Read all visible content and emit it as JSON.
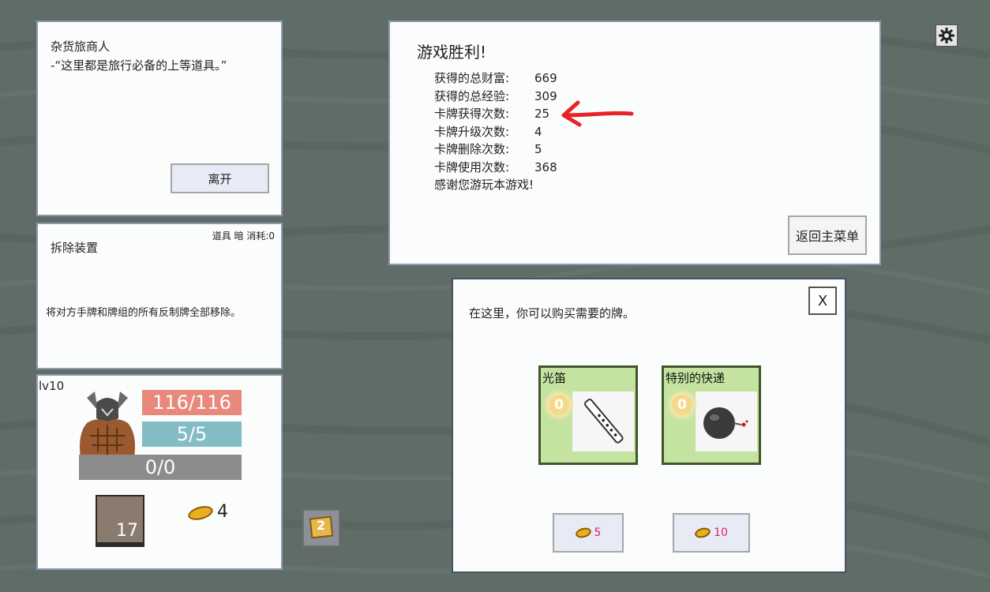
{
  "merchant": {
    "name": "杂货旅商人",
    "quote": "-“这里都是旅行必备的上等道具。”",
    "leave_label": "离开"
  },
  "card_info": {
    "meta": "道具 暗 消耗:0",
    "title": "拆除装置",
    "description": "将对方手牌和牌组的所有反制牌全部移除。"
  },
  "player": {
    "level": "lv10",
    "hp": "116/116",
    "mp": "5/5",
    "xp": "0/0",
    "deck_count": "17",
    "gold": "4",
    "pack_count": "2"
  },
  "victory": {
    "title": "游戏胜利!",
    "stats": [
      {
        "label": "获得的总财富:",
        "value": "669"
      },
      {
        "label": "获得的总经验:",
        "value": "309"
      },
      {
        "label": "卡牌获得次数:",
        "value": "25"
      },
      {
        "label": "卡牌升级次数:",
        "value": "4"
      },
      {
        "label": "卡牌删除次数:",
        "value": "5"
      },
      {
        "label": "卡牌使用次数:",
        "value": "368"
      }
    ],
    "thanks": "感谢您游玩本游戏!",
    "menu_label": "返回主菜单"
  },
  "shop": {
    "intro": "在这里，你可以购买需要的牌。",
    "close_label": "X",
    "items": [
      {
        "name": "光笛",
        "cost": "0",
        "price": "5"
      },
      {
        "name": "特别的快递",
        "cost": "0",
        "price": "10"
      }
    ]
  },
  "colors": {
    "background": "#5f6d66",
    "hp_bar": "#e8897c",
    "mp_bar": "#84bcc6",
    "xp_bar": "#8c8c8c",
    "card_bg": "#c4e3a0",
    "price_text": "#e0245e",
    "arrow": "#e8242a"
  },
  "icons": [
    "settings-gear-icon",
    "coin-icon",
    "hand-drawn-arrow-annotation",
    "flute-art",
    "bomb-art",
    "deck-pile-icon",
    "card-pack-icon"
  ]
}
